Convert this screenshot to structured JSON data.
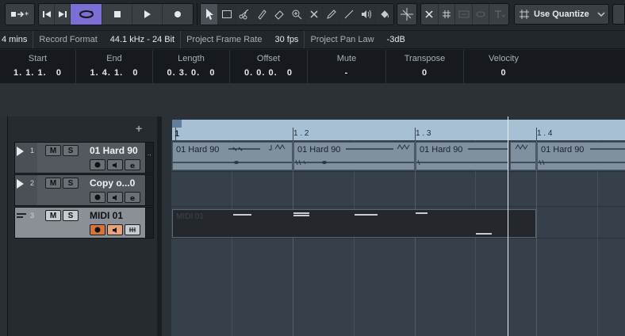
{
  "toolbar": {
    "transport_buttons": [
      "go-to-start",
      "go-to-end",
      "cycle",
      "stop",
      "play",
      "record"
    ],
    "tool_buttons": [
      "object-selection",
      "range-selection",
      "split",
      "glue",
      "erase",
      "zoom",
      "mute",
      "draw",
      "line",
      "play-tool",
      "color"
    ],
    "quantize_label": "Use Quantize",
    "accent_cycle": "#7b6fd6"
  },
  "statusbar": {
    "max_record_time": "4 mins",
    "record_format_label": "Record Format",
    "record_format_value": "44.1 kHz - 24 Bit",
    "frame_rate_label": "Project Frame Rate",
    "frame_rate_value": "30 fps",
    "pan_law_label": "Project Pan Law",
    "pan_law_value": "-3dB"
  },
  "infoline": {
    "start_label": "Start",
    "start_value": "1. 1. 1.   0",
    "end_label": "End",
    "end_value": "1. 4. 1.   0",
    "length_label": "Length",
    "length_value": "0. 3. 0.   0",
    "offset_label": "Offset",
    "offset_value": "0. 0. 0.   0",
    "mute_label": "Mute",
    "mute_value": "-",
    "transpose_label": "Transpose",
    "transpose_value": "0",
    "velocity_label": "Velocity",
    "velocity_value": "0"
  },
  "tracklist": {
    "add_label": "+",
    "tracks": [
      {
        "number": "1",
        "name": "01 Hard 90",
        "type": "audio",
        "mute": "M",
        "solo": "S"
      },
      {
        "number": "2",
        "name": "Copy o...0",
        "type": "audio",
        "mute": "M",
        "solo": "S"
      },
      {
        "number": "3",
        "name": "MIDI 01",
        "type": "midi",
        "mute": "M",
        "solo": "S"
      }
    ]
  },
  "ruler": {
    "labels": [
      "1",
      "1 . 2",
      "1 . 3",
      "1 . 4"
    ]
  },
  "parts": {
    "audio": [
      "01 Hard 90",
      "01 Hard 90",
      "01 Hard 90",
      "01 Hard 90"
    ],
    "midi": "MIDI 01"
  }
}
